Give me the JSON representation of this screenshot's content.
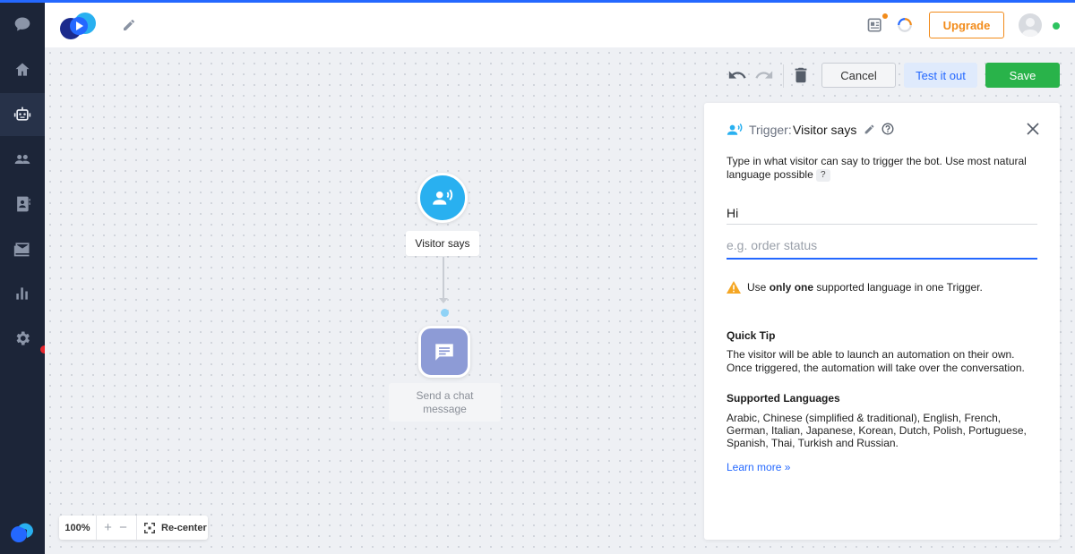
{
  "colors": {
    "accent": "#2468ff",
    "upgrade": "#f28b1a",
    "save": "#29b34a",
    "trigger_node": "#29b0f0",
    "message_node": "#8d9bd6",
    "sidebar": "#1c2538"
  },
  "sidebar": {
    "items": [
      {
        "name": "chats",
        "icon": "chat-bubble-icon"
      },
      {
        "name": "home",
        "icon": "home-icon"
      },
      {
        "name": "chatbots",
        "icon": "bot-icon",
        "active": true
      },
      {
        "name": "visitors",
        "icon": "people-icon"
      },
      {
        "name": "contacts",
        "icon": "contact-book-icon"
      },
      {
        "name": "mailing",
        "icon": "mail-icon"
      },
      {
        "name": "analytics",
        "icon": "bar-chart-icon"
      },
      {
        "name": "settings",
        "icon": "gear-icon"
      }
    ]
  },
  "header": {
    "upgrade_label": "Upgrade"
  },
  "toolbar": {
    "cancel_label": "Cancel",
    "test_label": "Test it out",
    "save_label": "Save"
  },
  "flow": {
    "trigger_node_label": "Visitor says",
    "message_node_label": "Send a chat message"
  },
  "zoom": {
    "value": "100%",
    "plus": "+",
    "minus": "−",
    "recenter_label": "Re-center"
  },
  "panel": {
    "title_prefix": "Trigger:",
    "title": "Visitor says",
    "description": "Type in what visitor can say to trigger the bot. Use most natural language possible",
    "help_mark": "?",
    "phrases": [
      "Hi"
    ],
    "input_placeholder": "e.g. order status",
    "warning_prefix": "Use ",
    "warning_bold": "only one",
    "warning_suffix": " supported language in one Trigger.",
    "tip_title": "Quick Tip",
    "tip_text": "The visitor will be able to launch an automation on their own. Once triggered, the automation will take over the conversation.",
    "languages_title": "Supported Languages",
    "languages_text": "Arabic, Chinese (simplified & traditional), English, French, German, Italian, Japanese, Korean, Dutch, Polish, Portuguese, Spanish, Thai, Turkish and Russian.",
    "learn_more": "Learn more »"
  }
}
